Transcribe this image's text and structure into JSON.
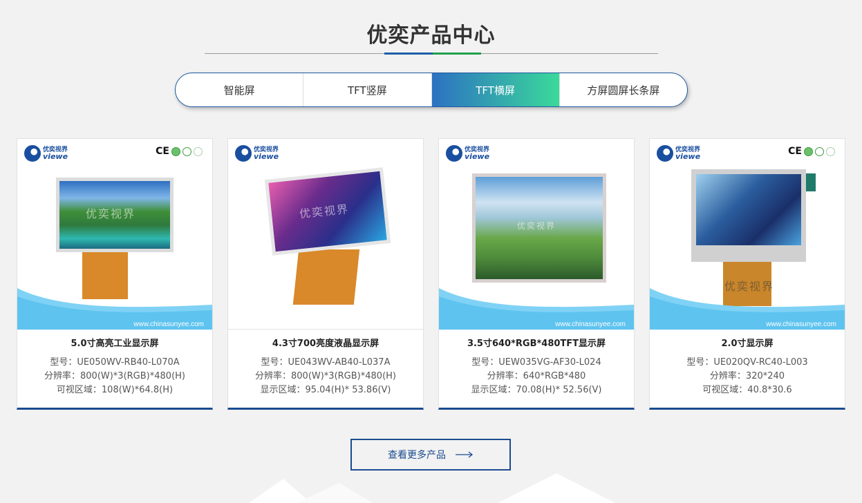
{
  "section": {
    "title": "优奕产品中心"
  },
  "tabs": [
    {
      "label": "智能屏",
      "active": false
    },
    {
      "label": "TFT竖屏",
      "active": false
    },
    {
      "label": "TFT横屏",
      "active": true
    },
    {
      "label": "方屏圆屏长条屏",
      "active": false
    }
  ],
  "brand": {
    "cn": "优奕视界",
    "en": "viewe",
    "watermark": "优奕视界",
    "website": "www.chinasunyee.com",
    "ce": "CE"
  },
  "products": [
    {
      "name": "5.0寸高亮工业显示屏",
      "specs": [
        "型号：UE050WV-RB40-L070A",
        "分辨率：800(W)*3(RGB)*480(H)",
        "可视区域：108(W)*64.8(H)"
      ]
    },
    {
      "name": "4.3寸700亮度液晶显示屏",
      "specs": [
        "型号：UE043WV-AB40-L037A",
        "分辨率：800(W)*3(RGB)*480(H)",
        "显示区域：95.04(H)* 53.86(V)"
      ]
    },
    {
      "name": "3.5寸640*RGB*480TFT显示屏",
      "specs": [
        "型号：UEW035VG-AF30-L024",
        "分辨率：640*RGB*480",
        "显示区域：70.08(H)* 52.56(V)"
      ]
    },
    {
      "name": "2.0寸显示屏",
      "specs": [
        "型号：UE020QV-RC40-L003",
        "分辨率：320*240",
        "可视区域：40.8*30.6"
      ]
    }
  ],
  "more_button": {
    "label": "查看更多产品"
  },
  "colors": {
    "primary": "#1a4b8f",
    "tab_gradient_start": "#2d71c2",
    "tab_gradient_end": "#3ad99a",
    "wave": "#7fd2f5"
  }
}
